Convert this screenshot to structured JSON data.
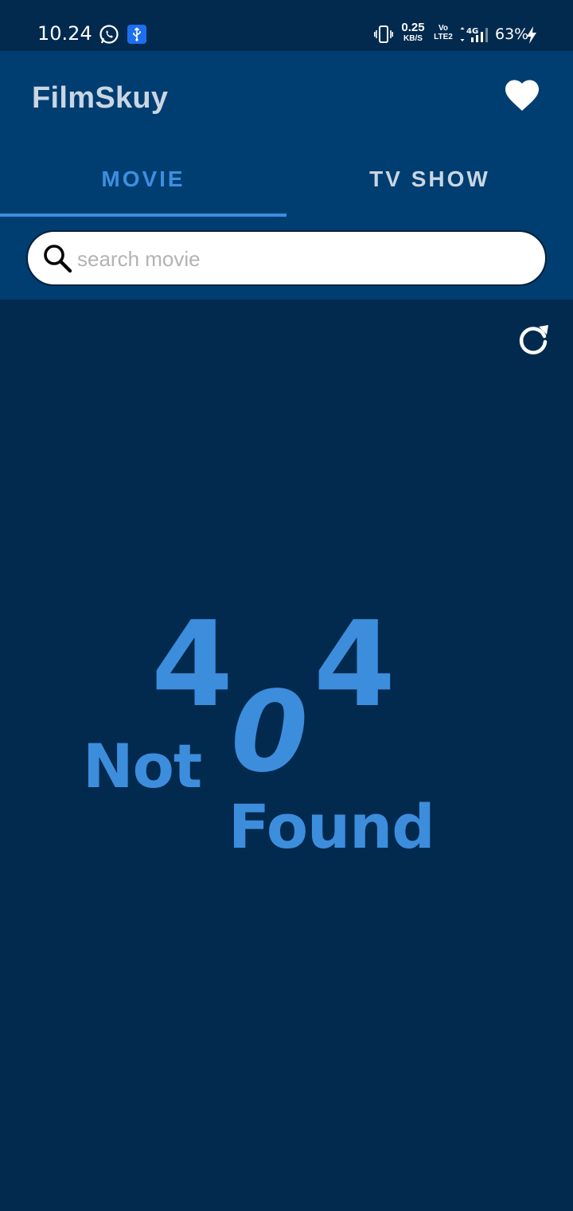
{
  "status_bar": {
    "time": "10.24",
    "net_speed_value": "0.25",
    "net_speed_unit": "KB/S",
    "volte_line1": "Vo",
    "volte_line2": "LTE2",
    "network_type": "4G",
    "battery": "63%",
    "icons": [
      "whatsapp-icon",
      "usb-icon",
      "vibrate-icon",
      "signal-icon",
      "charging-bolt-icon"
    ]
  },
  "app_bar": {
    "title": "FilmSkuy",
    "favorite_icon": "heart-icon"
  },
  "tabs": [
    {
      "label": "MOVIE",
      "selected": true
    },
    {
      "label": "TV SHOW",
      "selected": false
    }
  ],
  "search": {
    "placeholder": "search movie",
    "value": "",
    "icon": "search-icon"
  },
  "content": {
    "refresh_icon": "refresh-icon",
    "error": {
      "digit1": "4",
      "digit2": "0",
      "digit3": "4",
      "word1": "Not",
      "word2": "Found"
    }
  },
  "colors": {
    "background": "#022a4e",
    "app_bar": "#003d71",
    "accent": "#3c8fe0",
    "error_text": "#3d8ddd",
    "inactive_tab": "#c9d6e3"
  }
}
